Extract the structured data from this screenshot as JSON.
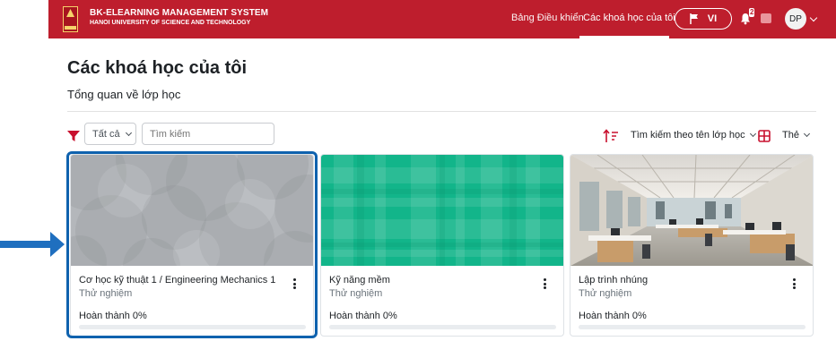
{
  "navbar": {
    "brand_title": "BK-ELEARNING MANAGEMENT SYSTEM",
    "brand_subtitle": "HANOI UNIVERSITY OF SCIENCE AND TECHNOLOGY",
    "links": [
      {
        "label": "Bảng Điều khiển",
        "active": false
      },
      {
        "label": "Các khoá học của tôi",
        "active": true
      }
    ],
    "language_label": "VI",
    "notification_count": "2",
    "user_initials": "DP",
    "brand_color": "#be1e2d"
  },
  "page": {
    "title": "Các khoá học của tôi",
    "section_title": "Tổng quan về lớp học"
  },
  "filters": {
    "grouping_selected": "Tất cả",
    "search_placeholder": "Tìm kiếm",
    "sort_selected": "Tìm kiếm theo tên lớp học",
    "view_selected": "Thẻ",
    "filter_icon_color": "#c8102e",
    "sort_icon_color": "#c8102e"
  },
  "courses": [
    {
      "name": "Cơ học kỹ thuật 1 / Engineering Mechanics 1",
      "category": "Thử nghiệm",
      "progress_label": "Hoàn thành 0%",
      "progress": 0,
      "image": "grey-circles-pattern",
      "highlighted": true
    },
    {
      "name": "Kỹ năng mềm",
      "category": "Thử nghiệm",
      "progress_label": "Hoàn thành 0%",
      "progress": 0,
      "image": "green-plaid-pattern",
      "highlighted": false
    },
    {
      "name": "Lập trình nhúng",
      "category": "Thử nghiệm",
      "progress_label": "Hoàn thành 0%",
      "progress": 0,
      "image": "office-photo",
      "highlighted": false
    }
  ],
  "annotation": {
    "arrow_color": "#1f6fbf",
    "highlight_color": "#0f62ae"
  }
}
